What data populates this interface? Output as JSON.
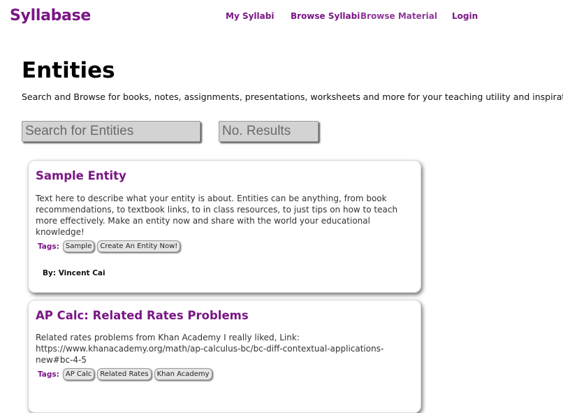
{
  "nav": {
    "logo": "Syllabase",
    "links": [
      "My Syllabi",
      "Browse Syllabi",
      "Browse Material",
      "Login"
    ]
  },
  "page": {
    "title": "Entities",
    "description": "Search and Browse for books, notes, assignments, presentations, worksheets and more for your teaching utility and inspiration."
  },
  "search": {
    "entities_placeholder": "Search for Entities",
    "entities_value": "",
    "results_placeholder": "No. Results",
    "results_value": ""
  },
  "entities": [
    {
      "title": "Sample Entity",
      "description": "Text here to describe what your entity is about. Entities can be anything, from book recommendations, to textbook links, to in class resources, to just tips on how to teach more effectively. Make an entity now and share with the world your educational knowledge!",
      "tags_label": "Tags:",
      "tags": [
        "Sample",
        "Create An Entity Now!"
      ],
      "author": "By: Vincent Cai"
    },
    {
      "title": "AP Calc: Related Rates Problems",
      "description": "Related rates problems from Khan Academy I really liked, Link: https://www.khanacademy.org/math/ap-calculus-bc/bc-diff-contextual-applications-new#bc-4-5",
      "tags_label": "Tags:",
      "tags": [
        "AP Calc",
        "Related Rates",
        "Khan Academy"
      ]
    }
  ],
  "colors": {
    "brand": "#7a1685",
    "input_bg": "#d3d3d3",
    "tag_bg": "#e6e6e6"
  }
}
